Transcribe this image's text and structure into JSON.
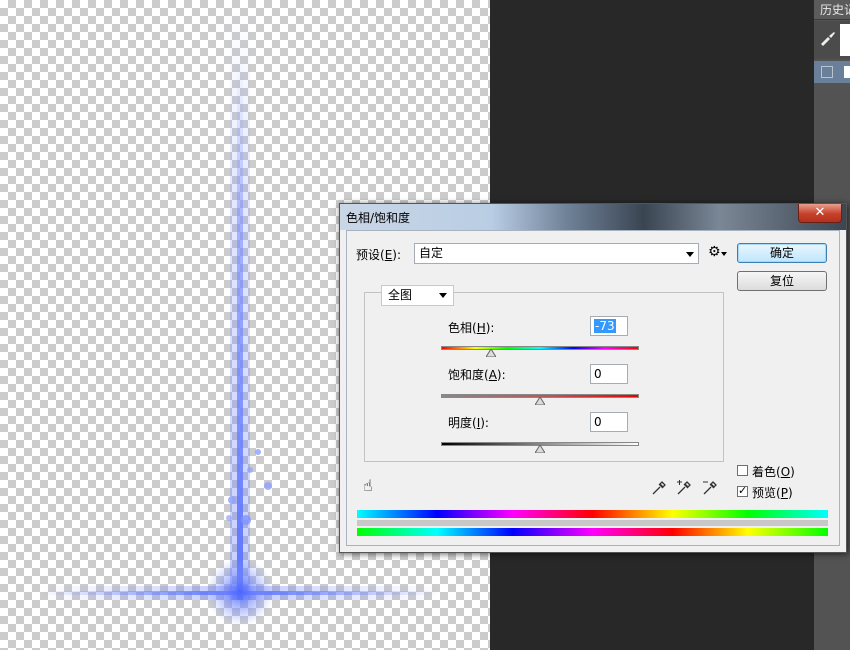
{
  "history_panel": {
    "tab_label": "历史记"
  },
  "dialog": {
    "title": "色相/饱和度",
    "close_label": "✕",
    "preset": {
      "label_prefix": "预设(",
      "label_key": "E",
      "label_suffix": "):",
      "value": "自定"
    },
    "buttons": {
      "ok": "确定",
      "reset": "复位"
    },
    "channel": {
      "value": "全图"
    },
    "hue": {
      "label_prefix": "色相(",
      "label_key": "H",
      "label_suffix": "):",
      "value": "-73",
      "slider_fraction": 0.25
    },
    "saturation": {
      "label_prefix": "饱和度(",
      "label_key": "A",
      "label_suffix": "):",
      "value": "0",
      "slider_fraction": 0.5
    },
    "lightness": {
      "label_prefix": "明度(",
      "label_key": "I",
      "label_suffix": "):",
      "value": "0",
      "slider_fraction": 0.5
    },
    "colorize": {
      "label_prefix": "着色(",
      "label_key": "O",
      "label_suffix": ")",
      "checked": false
    },
    "preview": {
      "label_prefix": "预览(",
      "label_key": "P",
      "label_suffix": ")",
      "checked": true
    },
    "icons": [
      "targeted-adjustment-hand-icon",
      "eyedropper-icon",
      "eyedropper-plus-icon",
      "eyedropper-minus-icon",
      "gear-icon"
    ]
  }
}
